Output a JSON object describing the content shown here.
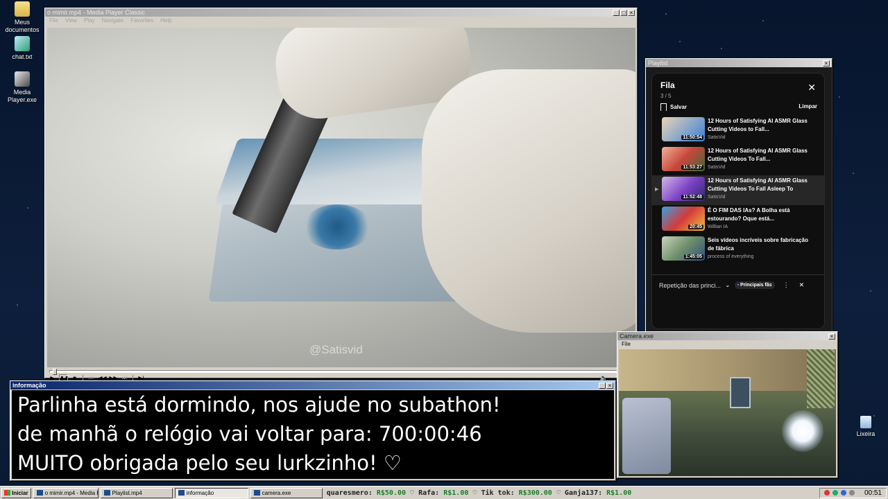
{
  "desktop": {
    "icons": [
      {
        "label": "Meus documentos",
        "icon": "folder-icon"
      },
      {
        "label": "chat.txt",
        "icon": "notepad-icon"
      },
      {
        "label": "Media Player.exe",
        "icon": "media-player-icon"
      },
      {
        "label": "Lixeira",
        "icon": "recycle-bin-icon"
      }
    ]
  },
  "media_player": {
    "title": "o mimir.mp4 - Media Player Classic",
    "menu": [
      "File",
      "View",
      "Play",
      "Navigate",
      "Favorites",
      "Help"
    ],
    "video_watermark": "@Satisvid",
    "seek_progress": 0.005
  },
  "playlist_window": {
    "title": "Playlist",
    "panel_title": "Fila",
    "position": "3 / 5",
    "save_label": "Salvar",
    "clear_label": "Limpar",
    "items": [
      {
        "title": "12 Hours of Satisfying AI ASMR Glass Cutting Videos to Fall...",
        "channel": "SatisVid",
        "duration": "11:50:54",
        "current": false,
        "thumb_color": "#3a7fd6"
      },
      {
        "title": "12 Hours of Satisfying AI ASMR Glass Cutting Videos To Fall...",
        "channel": "SatisVid",
        "duration": "11:53:27",
        "current": false,
        "thumb_color": "#c8463a"
      },
      {
        "title": "12 Hours of Satisfying AI ASMR Glass Cutting Videos To Fall Asleep To",
        "channel": "SatisVid",
        "duration": "11:52:48",
        "current": true,
        "thumb_color": "#7b3fc4"
      },
      {
        "title": "É O FIM DAS IAs? A Bolha está estourando? Oque está...",
        "channel": "Willian IA",
        "duration": "20:45",
        "current": false,
        "thumb_color": "#d43a3a"
      },
      {
        "title": "Seis vídeos incríveis sobre fabricação de fábrica",
        "channel": "process of everything",
        "duration": "1:45:05",
        "current": false,
        "thumb_color": "#6f8f6a"
      }
    ],
    "footer_label": "Repetição das princi...",
    "footer_pill": "Principais fãs"
  },
  "info_window": {
    "title": "informação",
    "lines": [
      "Parlinha está dormindo, nos ajude no subathon!",
      "de manhã o relógio vai voltar para:  700:00:46",
      "MUITO obrigada pelo seu lurkzinho! ♡"
    ]
  },
  "camera_window": {
    "title": "Camera.exe",
    "menu_file": "File"
  },
  "taskbar": {
    "start_label": "Iniciar",
    "tasks": [
      {
        "label": "o mimir.mp4 - Media Player Cl...",
        "active": false
      },
      {
        "label": "Playlist.mp4",
        "active": false
      },
      {
        "label": "informação",
        "active": true
      },
      {
        "label": "camera.exe",
        "active": false
      }
    ],
    "ticker": [
      {
        "name": "quaresmero:",
        "amount": "R$50.00"
      },
      {
        "name": "Rafa:",
        "amount": "R$1.00"
      },
      {
        "name": "Tik tok:",
        "amount": "R$300.00"
      },
      {
        "name": "Ganja137:",
        "amount": "R$1.00"
      }
    ],
    "ticker_separator": "♡",
    "clock": "00:51"
  }
}
